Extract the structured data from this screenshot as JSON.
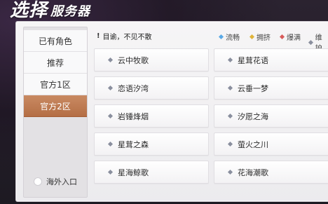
{
  "header": {
    "title_big": "选择",
    "title_small": "服务器"
  },
  "sidebar": {
    "items": [
      {
        "label": "已有角色"
      },
      {
        "label": "推荐"
      },
      {
        "label": "官方1区"
      },
      {
        "label": "官方2区"
      }
    ],
    "active_index": 3,
    "overseas_label": "海外入口"
  },
  "notice": {
    "icon": "!",
    "text": "目谕，不见不散"
  },
  "legend": [
    {
      "label": "流畅",
      "color": "#5aa9e6"
    },
    {
      "label": "拥挤",
      "color": "#e0b43a"
    },
    {
      "label": "爆满",
      "color": "#d85a5a"
    },
    {
      "label": "维护",
      "color": "#8a8f9e"
    }
  ],
  "servers": [
    {
      "name": "云中牧歌"
    },
    {
      "name": "星茸花语"
    },
    {
      "name": "恋语汐湾"
    },
    {
      "name": "云垂一梦"
    },
    {
      "name": "岩锤烽烟"
    },
    {
      "name": "汐愿之海"
    },
    {
      "name": "星茸之森"
    },
    {
      "name": "萤火之川"
    },
    {
      "name": "星海鲸歌"
    },
    {
      "name": "花海潮歌"
    }
  ],
  "colors": {
    "accent": "#b97350",
    "status_dot": "#8a8f9e"
  }
}
